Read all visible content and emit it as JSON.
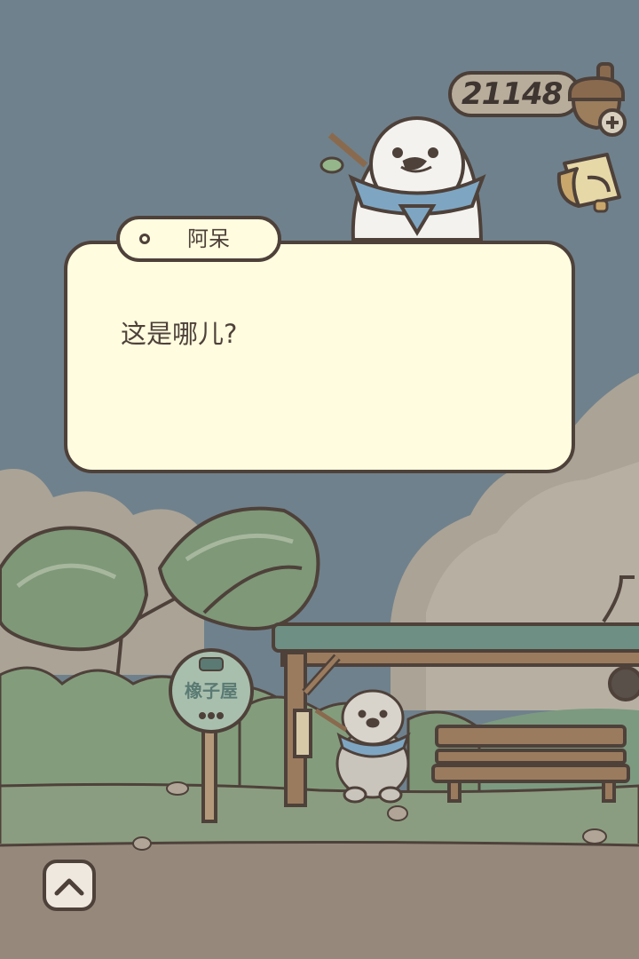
{
  "currency": {
    "amount": "21148",
    "icon": "acorn-icon",
    "add_icon": "plus-icon"
  },
  "dialog": {
    "speaker": "阿呆",
    "text": "这是哪儿?"
  },
  "bus_stop_sign": {
    "label": "橡子屋"
  },
  "controls": {
    "up_icon": "chevron-up-icon",
    "bag_icon": "bag-icon"
  },
  "colors": {
    "sky": "#6f818c",
    "dialog_bg": "#fffcdf",
    "outline": "#4e413a",
    "ground": "#96897b"
  }
}
